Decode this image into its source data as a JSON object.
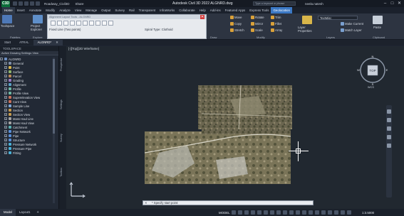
{
  "titlebar": {
    "app_icon": "C3D",
    "document_label": "Roadway_Civil3D",
    "share_label": "Share",
    "title": "Autodesk Civil 3D 2022   ALGNRD.dwg",
    "search_placeholder": "Type a keyword or phrase",
    "user": "neela.natesh",
    "window_controls": [
      "–",
      "□",
      "✕"
    ]
  },
  "ribbon_tabs": [
    "Home",
    "Insert",
    "Annotate",
    "Modify",
    "Analyze",
    "View",
    "Manage",
    "Output",
    "Survey",
    "Rail",
    "Transparent",
    "InfraWorks",
    "Collaborate",
    "Help",
    "Add-ins",
    "Featured Apps",
    "Express Tools",
    "Geolocation"
  ],
  "ribbon": {
    "toolspace_label": "Toolspace",
    "project_explorer_label": "Project Explorer",
    "palettes_label": "Palettes",
    "explore_label": "Explore",
    "floating_toolbar": {
      "title": "Alignment Layout Tools - ALGNRD",
      "close": "✕",
      "fixed_line": "Fixed Line (Two points)",
      "spiral_type": "Spiral Type: Clothoid"
    },
    "modify": {
      "move": "Move",
      "rotate": "Rotate",
      "trim": "Trim",
      "copy": "Copy",
      "mirror": "Mirror",
      "fillet": "Fillet",
      "stretch": "Stretch",
      "scale": "Scale",
      "array": "Array",
      "panel_label": "Modify"
    },
    "draw_label": "Draw",
    "layers": {
      "layer_properties": "Layer Properties",
      "make_current": "Make Current",
      "match_layer": "Match Layer",
      "dropdown": "TextMisc",
      "panel_label": "Layers"
    },
    "clipboard": {
      "paste": "Paste",
      "panel_label": "Clipboard"
    }
  },
  "doc_tabs": [
    {
      "label": "Start",
      "active": false
    },
    {
      "label": "ATRAL",
      "active": false
    },
    {
      "label": "ALGNRD*",
      "active": true
    }
  ],
  "toolspace": {
    "header": "TOOLSPACE",
    "view": "Active Drawing Settings View",
    "root": "ALGNRD",
    "items": [
      "General",
      "Point",
      "Surface",
      "Parcel",
      "Grading",
      "Alignment",
      "Profile",
      "Profile View",
      "Superelevation View",
      "Cant View",
      "Sample Line",
      "Section",
      "Section View",
      "Mass Haul Line",
      "Mass Haul View",
      "Catchment",
      "Pipe Network",
      "Pipe",
      "Structure",
      "Pressure Network",
      "Pressure Pipe",
      "Fitting"
    ],
    "side_tabs": [
      "Prospector",
      "Settings",
      "Survey",
      "Toolbox"
    ]
  },
  "viewport": {
    "label": "[-][Top][2D Wireframe]",
    "viewcube": {
      "face": "TOP",
      "n": "N",
      "s": "S",
      "e": "E",
      "w": "W",
      "wcs": "WCS"
    }
  },
  "command_line": {
    "prompt": "* Specify start point:",
    "close": "✕"
  },
  "statusbar": {
    "tabs": [
      {
        "label": "Model",
        "active": true
      },
      {
        "label": "Layout1",
        "active": false
      }
    ],
    "add": "+",
    "model_label": "MODEL",
    "scale": "1:3.5000"
  }
}
